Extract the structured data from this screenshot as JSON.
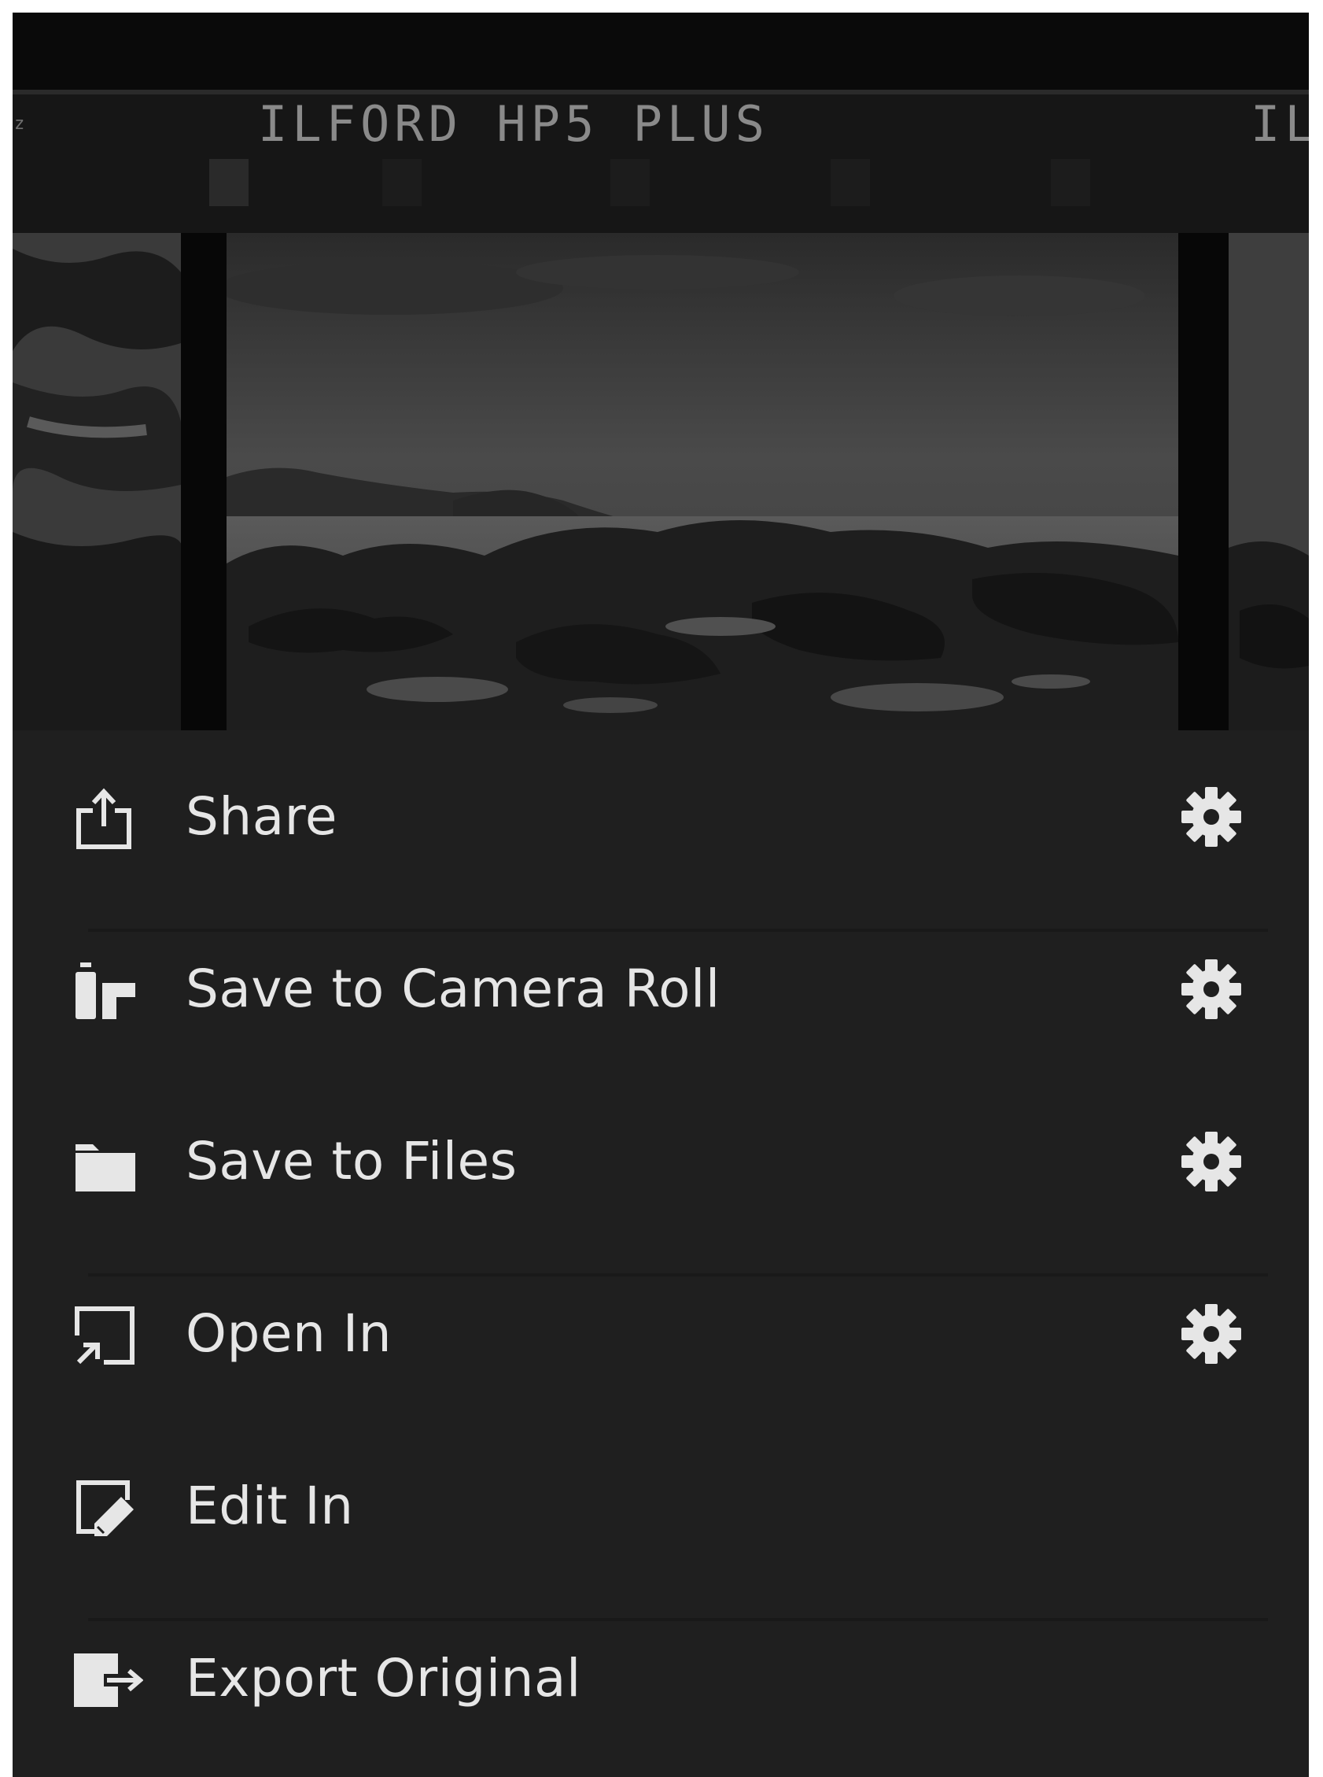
{
  "photo": {
    "film_label": "ILFORD HP5 PLUS",
    "film_label_partial": "ILI",
    "film_edge_mark": "z"
  },
  "menu": {
    "items": [
      {
        "label": "Share",
        "icon": "share-icon",
        "has_settings": true
      },
      {
        "label": "Save to Camera Roll",
        "icon": "camera-roll-icon",
        "has_settings": true
      },
      {
        "label": "Save to Files",
        "icon": "folder-icon",
        "has_settings": true
      },
      {
        "label": "Open In",
        "icon": "open-in-icon",
        "has_settings": true
      },
      {
        "label": "Edit In",
        "icon": "edit-in-icon",
        "has_settings": false
      },
      {
        "label": "Export Original",
        "icon": "export-icon",
        "has_settings": false
      }
    ],
    "settings_icon": "gear-icon"
  },
  "colors": {
    "sheet_background": "#1f1f1f",
    "text": "#e6e6e6",
    "icon": "#e6e6e6"
  }
}
